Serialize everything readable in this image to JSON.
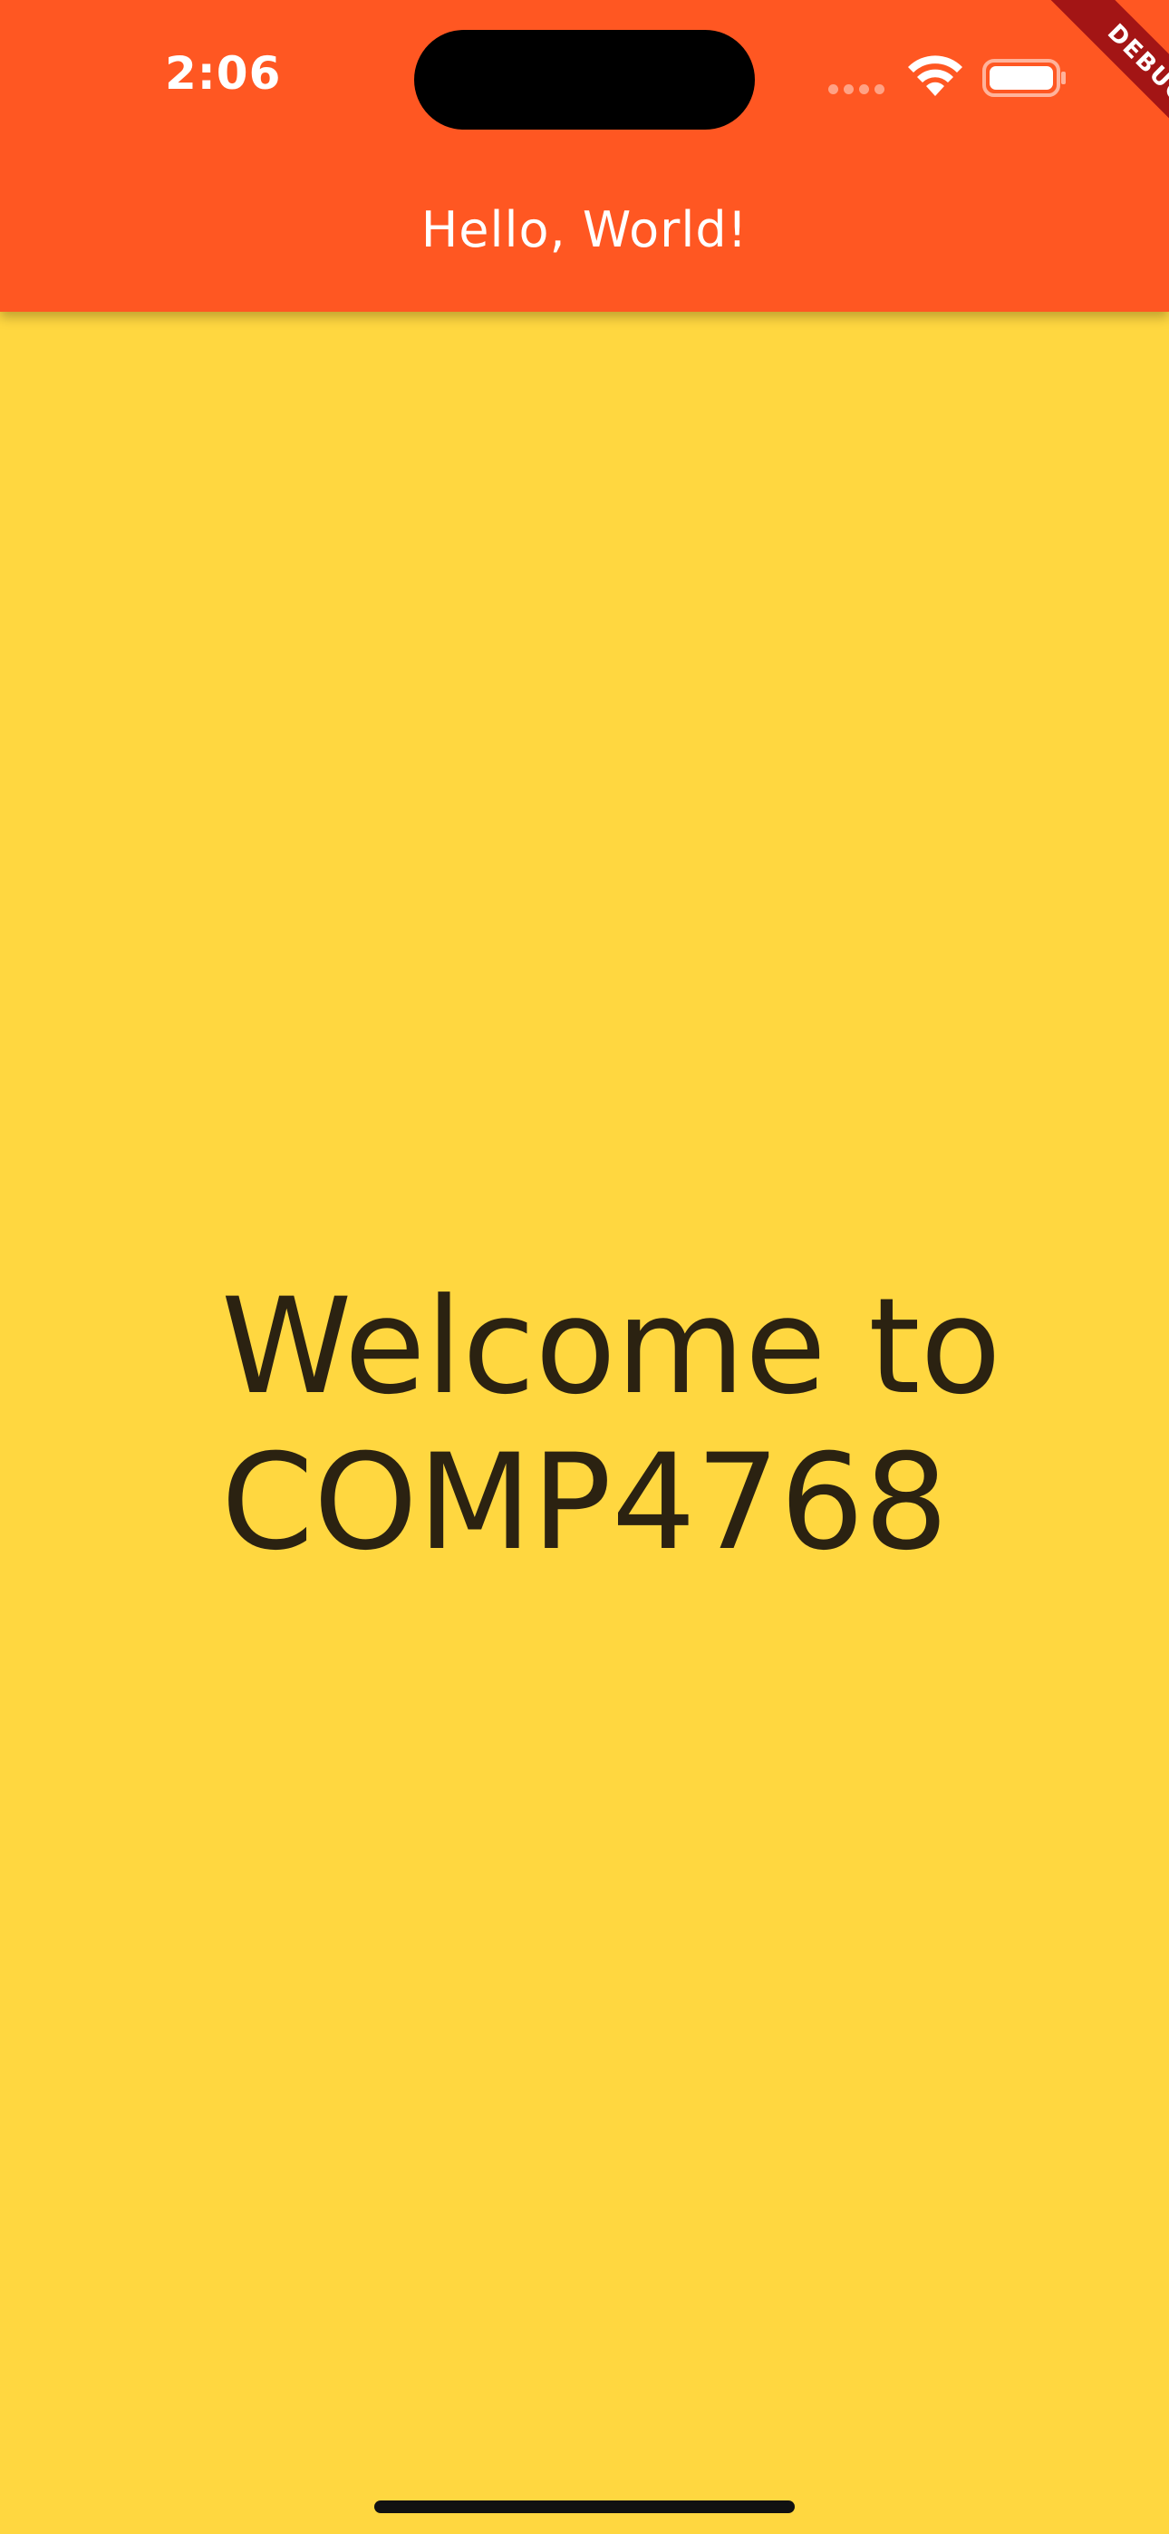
{
  "status_bar": {
    "time": "2:06",
    "icons": [
      "signal-icon",
      "wifi-icon",
      "battery-icon"
    ]
  },
  "app_bar": {
    "title": "Hello, World!",
    "background_color": "#FF5722"
  },
  "debug_banner": {
    "label": "DEBUG"
  },
  "main": {
    "background_color": "#FFD740",
    "welcome_line_1": "Welcome to",
    "welcome_line_2": "COMP4768"
  }
}
